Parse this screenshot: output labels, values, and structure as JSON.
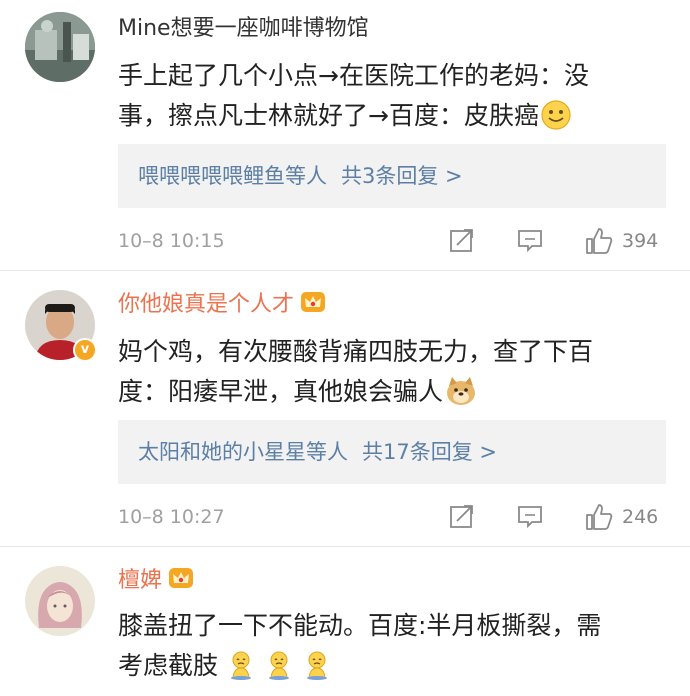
{
  "comments": [
    {
      "username": "Mine想要一座咖啡博物馆",
      "line1": "手上起了几个小点→在医院工作的老妈：没",
      "line2": "事，擦点凡士林就好了→百度：皮肤癌",
      "emoji": "smile-emoji",
      "reply_names": "喂喂喂喂喂鲤鱼",
      "reply_etc": "等人",
      "reply_count": "共3条回复 >",
      "time": "10–8 10:15",
      "likes": "394"
    },
    {
      "username": "你他娘真是个人才",
      "line1": "妈个鸡，有次腰酸背痛四肢无力，查了下百",
      "line2": "度：阳痿早泄，真他娘会骗人",
      "emoji": "doge-emoji",
      "verified_mark": "v",
      "reply_names": "太阳和她的小星星",
      "reply_etc": "等人",
      "reply_count": "共17条回复 >",
      "time": "10–8 10:27",
      "likes": "246"
    },
    {
      "username": "檀婢",
      "line1": "膝盖扭了一下不能动。百度:半月板撕裂，需",
      "line2": "考虑截肢",
      "emoji": "sad-sitting-emoji"
    }
  ],
  "colors": {
    "vip_name": "#eb7350",
    "reply_link": "#5d7fa6",
    "meta_gray": "#a0a0a0",
    "crown": "#f5a623"
  }
}
